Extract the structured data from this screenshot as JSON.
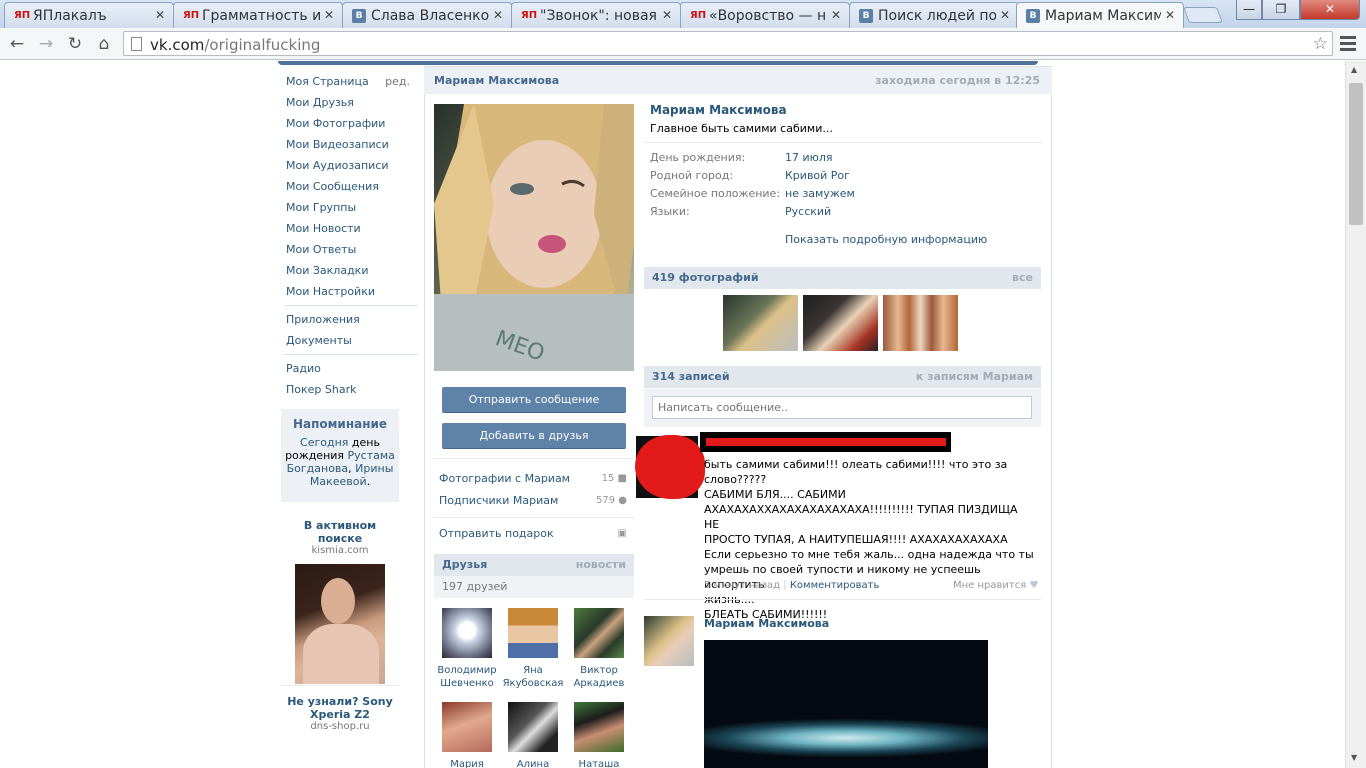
{
  "browser": {
    "tabs": [
      {
        "title": "ЯПлакалъ",
        "icon": "yap"
      },
      {
        "title": "Грамматность и",
        "icon": "yap"
      },
      {
        "title": "Слава Власенко",
        "icon": "vk"
      },
      {
        "title": "\"Звонок\": новая",
        "icon": "yap"
      },
      {
        "title": "«Воровство — н",
        "icon": "yap"
      },
      {
        "title": "Поиск людей по",
        "icon": "vk"
      },
      {
        "title": "Мариам Максим",
        "icon": "vk"
      }
    ],
    "url_domain": "vk.com",
    "url_path": "/originalfucking",
    "window_controls": {
      "minimize": "—",
      "restore": "❐",
      "close": "✕"
    }
  },
  "left_menu": {
    "items": [
      "Моя Страница",
      "Мои Друзья",
      "Мои Фотографии",
      "Мои Видеозаписи",
      "Мои Аудиозаписи",
      "Мои Сообщения",
      "Мои Группы",
      "Мои Новости",
      "Мои Ответы",
      "Мои Закладки",
      "Мои Настройки"
    ],
    "edit_label": "ред.",
    "extra_items": [
      "Приложения",
      "Документы"
    ],
    "extra_items2": [
      "Радио",
      "Покер Shark"
    ]
  },
  "reminder": {
    "title": "Напоминание",
    "text_today": "Сегодня",
    "text_bday": "день рождения",
    "name1": "Рустама Богданова",
    "and": ",",
    "name2": "Ирины Макеевой",
    "dot": "."
  },
  "ads": [
    {
      "title": "В активном поиске",
      "domain": "kismia.com"
    },
    {
      "title": "Не узнали? Sony Xperia Z2",
      "domain": "dns-shop.ru"
    }
  ],
  "profile": {
    "header_name": "Мариам Максимова",
    "online": "заходила сегодня в 12:25",
    "name": "Мариам Максимова",
    "status": "Главное быть самими сабими...",
    "info": [
      {
        "label": "День рождения:",
        "value": "17 июля"
      },
      {
        "label": "Родной город:",
        "value": "Кривой Рог"
      },
      {
        "label": "Семейное положение:",
        "value": "не замужем"
      },
      {
        "label": "Языки:",
        "value": "Русский"
      }
    ],
    "show_more": "Показать подробную информацию",
    "send_message": "Отправить сообщение",
    "add_friend": "Добавить в друзья",
    "side_links": [
      {
        "label": "Фотографии с Мариам",
        "count": "15"
      },
      {
        "label": "Подписчики Мариам",
        "count": "579"
      }
    ],
    "gift": "Отправить подарок"
  },
  "friends": {
    "title": "Друзья",
    "news": "новости",
    "count": "197 друзей",
    "list": [
      {
        "first": "Володимир",
        "last": "Шевченко"
      },
      {
        "first": "Яна",
        "last": "Якубовская"
      },
      {
        "first": "Виктор",
        "last": "Аркадиев"
      },
      {
        "first": "Мария",
        "last": ""
      },
      {
        "first": "Алина",
        "last": ""
      },
      {
        "first": "Наташа",
        "last": ""
      }
    ]
  },
  "photos": {
    "title": "419 фотографий",
    "all": "все"
  },
  "wall": {
    "title": "314 записей",
    "to_records": "к записям Мариам",
    "placeholder": "Написать сообщение..",
    "post1": {
      "lines": [
        "быть самими сабими!!! олеать сабими!!!! что это за слово?????",
        "САБИМИ БЛЯ.... САБИМИ",
        "АХАХАХАХХАХАХАХАХАХАХА!!!!!!!!!! ТУПАЯ ПИЗДИЩА НЕ",
        "ПРОСТО ТУПАЯ, А НАИТУПЕШАЯ!!!! АХАХАХАХАХАХА",
        "Если серьезно то мне тебя жаль... одна надежда что ты",
        "умрешь по своей тупости и никому не успеешь испортить",
        "жизнь....",
        "БЛЕАТЬ САБИМИ!!!!!!"
      ],
      "time": "5 минут назад",
      "sep": "|",
      "comment": "Комментировать",
      "like": "Мне нравится"
    },
    "post2_author": "Мариам Максимова"
  }
}
